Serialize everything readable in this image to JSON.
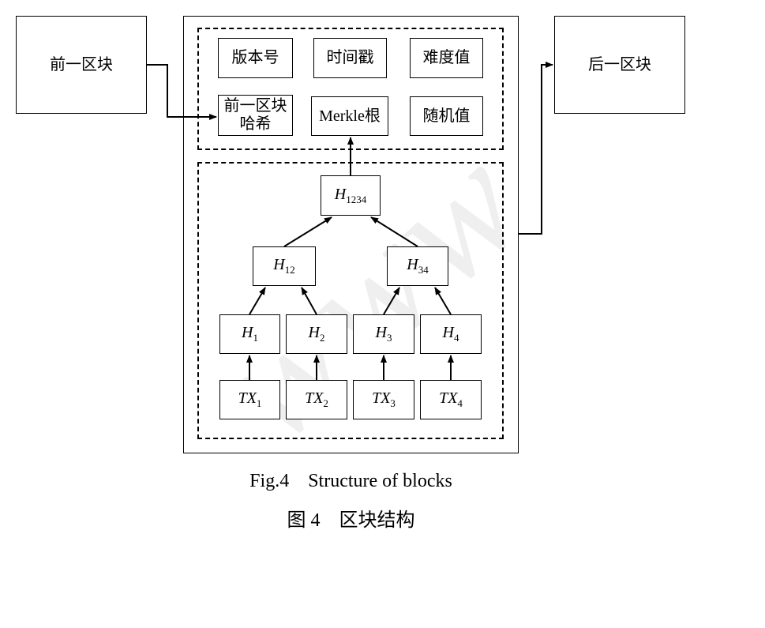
{
  "blocks": {
    "prev": "前一区块",
    "next": "后一区块"
  },
  "header": {
    "version": "版本号",
    "timestamp": "时间戳",
    "difficulty": "难度值",
    "prev_hash_line1": "前一区块",
    "prev_hash_line2": "哈希",
    "merkle_root": "Merkle根",
    "nonce": "随机值"
  },
  "merkle": {
    "root": {
      "base": "H",
      "sub": "1234"
    },
    "h12": {
      "base": "H",
      "sub": "12"
    },
    "h34": {
      "base": "H",
      "sub": "34"
    },
    "h1": {
      "base": "H",
      "sub": "1"
    },
    "h2": {
      "base": "H",
      "sub": "2"
    },
    "h3": {
      "base": "H",
      "sub": "3"
    },
    "h4": {
      "base": "H",
      "sub": "4"
    },
    "tx1": {
      "base": "TX",
      "sub": "1"
    },
    "tx2": {
      "base": "TX",
      "sub": "2"
    },
    "tx3": {
      "base": "TX",
      "sub": "3"
    },
    "tx4": {
      "base": "TX",
      "sub": "4"
    }
  },
  "caption": {
    "en": "Fig.4    Structure of blocks",
    "zh": "图 4    区块结构"
  },
  "watermark": "www"
}
